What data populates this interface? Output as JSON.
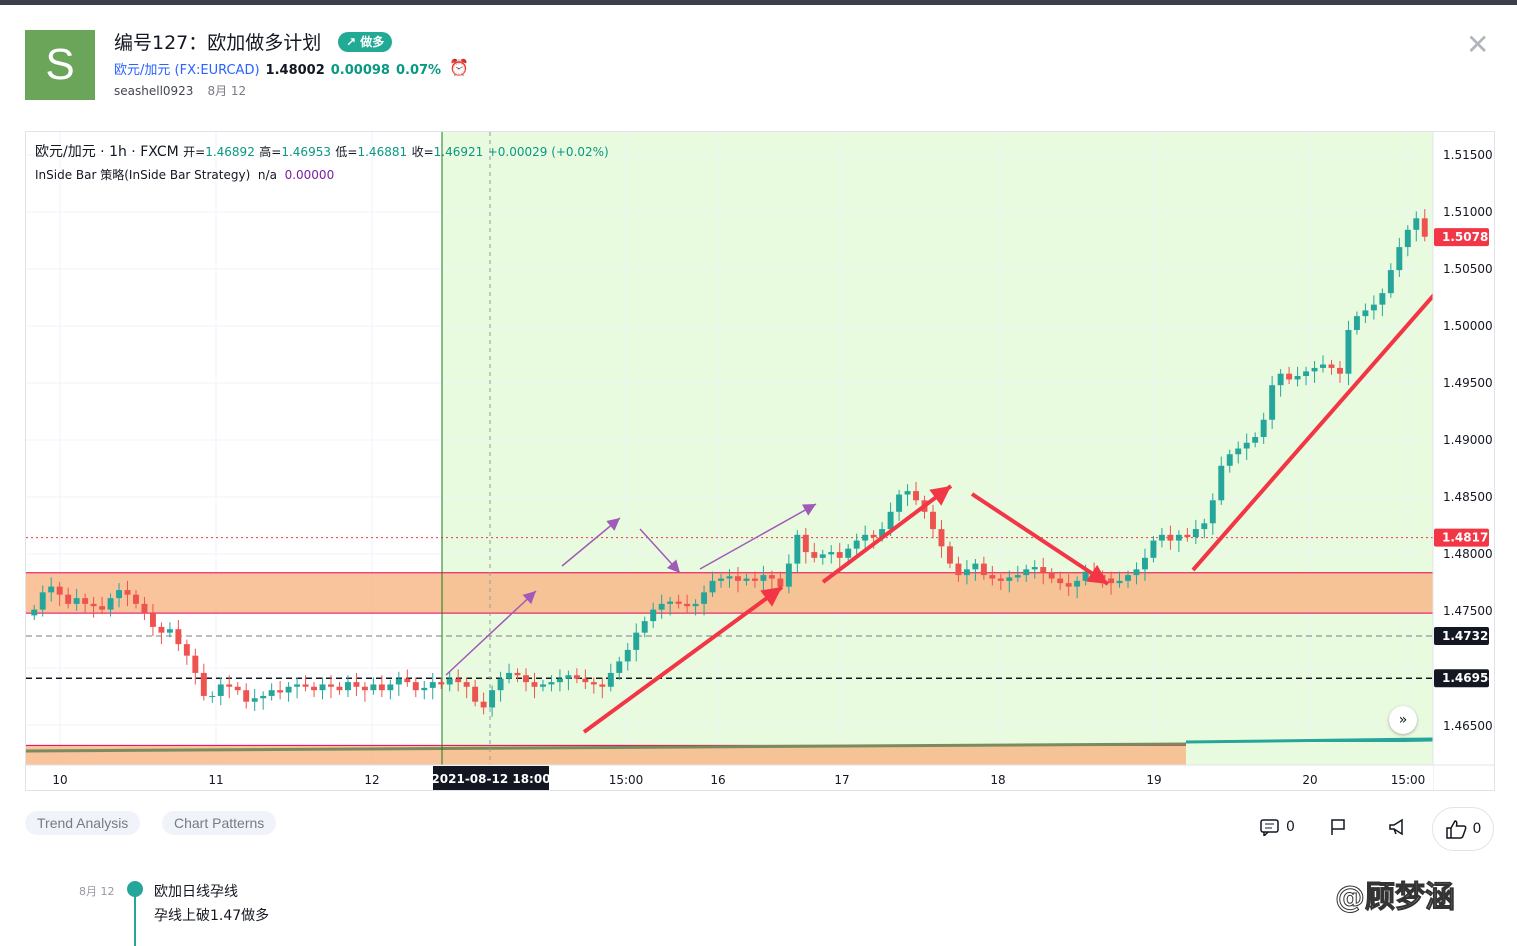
{
  "header": {
    "avatar_letter": "S",
    "title": "编号127：欧加做多计划",
    "badge": "↗ 做多",
    "symbol_name": "欧元/加元",
    "symbol_code": "(FX:EURCAD)",
    "price": "1.48002",
    "change": "0.00098",
    "change_pct": "0.07%",
    "author": "seashell0923",
    "date": "8月 12",
    "close_icon": "close-icon",
    "alarm_icon": "alarm-clock-icon"
  },
  "chart_legend": {
    "symbol": "欧元/加元 · 1h · FXCM",
    "open_label": "开=",
    "open": "1.46892",
    "high_label": "高=",
    "high": "1.46953",
    "low_label": "低=",
    "low": "1.46881",
    "close_label": "收=",
    "close": "1.46921",
    "change": "+0.00029 (+0.02%)",
    "indicator": "InSide Bar 策略(InSide Bar Strategy)",
    "indicator_na": "n/a",
    "indicator_value": "0.00000"
  },
  "chart_data": {
    "type": "candlestick",
    "symbol": "欧元/加元",
    "interval": "1h",
    "source": "FXCM",
    "ylim": [
      1.462,
      1.517
    ],
    "y_ticks": [
      "1.51500",
      "1.51000",
      "1.50500",
      "1.50000",
      "1.49500",
      "1.49000",
      "1.48500",
      "1.48000",
      "1.47500",
      "1.46500"
    ],
    "x_ticks": [
      "10",
      "11",
      "12",
      "15:00",
      "16",
      "17",
      "18",
      "19",
      "20",
      "15:00"
    ],
    "crosshair_label": "2021-08-12   18:00",
    "price_labels": [
      {
        "value": "1.50787",
        "color": "#f23645"
      },
      {
        "value": "1.48176",
        "color": "#f23645"
      },
      {
        "value": "1.47321",
        "color": "#131722"
      },
      {
        "value": "1.46954",
        "color": "#131722"
      }
    ],
    "zones": [
      {
        "from": 1.4752,
        "to": 1.4787,
        "color": "#f8b889"
      },
      {
        "from": 1.4618,
        "to": 1.4637,
        "color": "#f8b889"
      }
    ],
    "horizontal_lines": [
      {
        "value": 1.48176,
        "style": "dotted",
        "color": "#f23645"
      },
      {
        "value": 1.47321,
        "style": "dashed",
        "color": "#787b86"
      },
      {
        "value": 1.46954,
        "style": "dashed",
        "color": "#131722"
      }
    ],
    "closes": [
      1.4755,
      1.477,
      1.4775,
      1.4768,
      1.476,
      1.4765,
      1.476,
      1.4758,
      1.4755,
      1.4765,
      1.4772,
      1.4768,
      1.476,
      1.4752,
      1.474,
      1.4735,
      1.4738,
      1.4725,
      1.4715,
      1.47,
      1.468,
      1.468,
      1.469,
      1.4688,
      1.4685,
      1.4675,
      1.4678,
      1.468,
      1.4685,
      1.4683,
      1.4688,
      1.469,
      1.4688,
      1.4685,
      1.469,
      1.4688,
      1.4685,
      1.4692,
      1.4688,
      1.4685,
      1.469,
      1.4685,
      1.469,
      1.4695,
      1.4692,
      1.4685,
      1.4687,
      1.4692,
      1.469,
      1.4695,
      1.4692,
      1.4688,
      1.4675,
      1.467,
      1.4685,
      1.4695,
      1.47,
      1.4698,
      1.4692,
      1.4688,
      1.469,
      1.4692,
      1.4695,
      1.4698,
      1.4695,
      1.4692,
      1.469,
      1.4688,
      1.47,
      1.471,
      1.472,
      1.4735,
      1.4745,
      1.4755,
      1.476,
      1.4762,
      1.476,
      1.4758,
      1.476,
      1.477,
      1.478,
      1.4782,
      1.4784,
      1.478,
      1.4782,
      1.478,
      1.4785,
      1.4782,
      1.4775,
      1.4795,
      1.482,
      1.4805,
      1.48,
      1.4803,
      1.4805,
      1.48,
      1.4808,
      1.4815,
      1.482,
      1.4818,
      1.4825,
      1.484,
      1.4855,
      1.4858,
      1.485,
      1.484,
      1.4825,
      1.481,
      1.4795,
      1.4785,
      1.479,
      1.4795,
      1.4785,
      1.4782,
      1.478,
      1.4783,
      1.4785,
      1.479,
      1.4792,
      1.4787,
      1.4782,
      1.4778,
      1.4775,
      1.478,
      1.4788,
      1.4785,
      1.4782,
      1.4778,
      1.478,
      1.4785,
      1.479,
      1.48,
      1.4815,
      1.482,
      1.4815,
      1.482,
      1.4818,
      1.4825,
      1.483,
      1.485,
      1.488,
      1.489,
      1.4895,
      1.49,
      1.4905,
      1.492,
      1.495,
      1.496,
      1.4955,
      1.4958,
      1.4962,
      1.4965,
      1.4968,
      1.4965,
      1.496,
      1.4998,
      1.501,
      1.5015,
      1.502,
      1.503,
      1.505,
      1.507,
      1.5085,
      1.5095,
      1.5079
    ]
  },
  "annotations": {
    "arrows_purple": 4,
    "arrows_red": 4
  },
  "tags": [
    "Trend Analysis",
    "Chart Patterns"
  ],
  "actions": {
    "comments_count": "0",
    "likes_count": "0",
    "comment_icon": "comment-icon",
    "flag_icon": "flag-icon",
    "share_icon": "megaphone-icon",
    "like_icon": "thumbs-up-icon"
  },
  "timeline": {
    "date": "8月 12",
    "title": "欧加日线孕线",
    "text": "孕线上破1.47做多"
  },
  "watermark": "@顾梦涵"
}
